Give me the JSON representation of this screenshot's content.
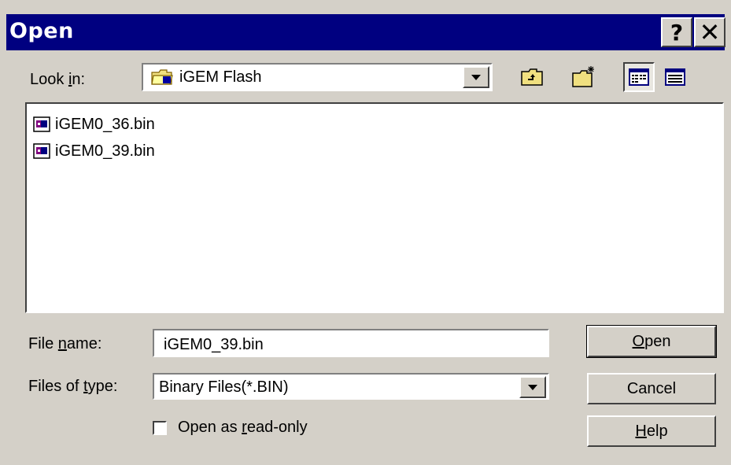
{
  "window": {
    "title": "Open",
    "help_glyph": "?",
    "close_glyph": "✕"
  },
  "lookin": {
    "label_pre": "Look ",
    "label_key": "i",
    "label_post": "n:",
    "value": "iGEM Flash",
    "icon": "folder-icon"
  },
  "toolbar": {
    "icons": [
      "up-folder-icon",
      "new-folder-icon",
      "list-view-icon",
      "details-view-icon"
    ]
  },
  "files": [
    {
      "name": "iGEM0_36.bin",
      "icon": "bin-file-icon"
    },
    {
      "name": "iGEM0_39.bin",
      "icon": "bin-file-icon"
    }
  ],
  "filename": {
    "label_pre": "File ",
    "label_key": "n",
    "label_post": "ame:",
    "value": "iGEM0_39.bin"
  },
  "filetype": {
    "label_pre": "Files of ",
    "label_key": "t",
    "label_post": "ype:",
    "value": "Binary Files(*.BIN)"
  },
  "readonly": {
    "label_pre": "Open as ",
    "label_key": "r",
    "label_post": "ead-only",
    "checked": false
  },
  "buttons": {
    "open_key": "O",
    "open_rest": "pen",
    "cancel": "Cancel",
    "help_key": "H",
    "help_rest": "elp"
  },
  "colors": {
    "titlebar": "#000080",
    "face": "#d4d0c8"
  }
}
